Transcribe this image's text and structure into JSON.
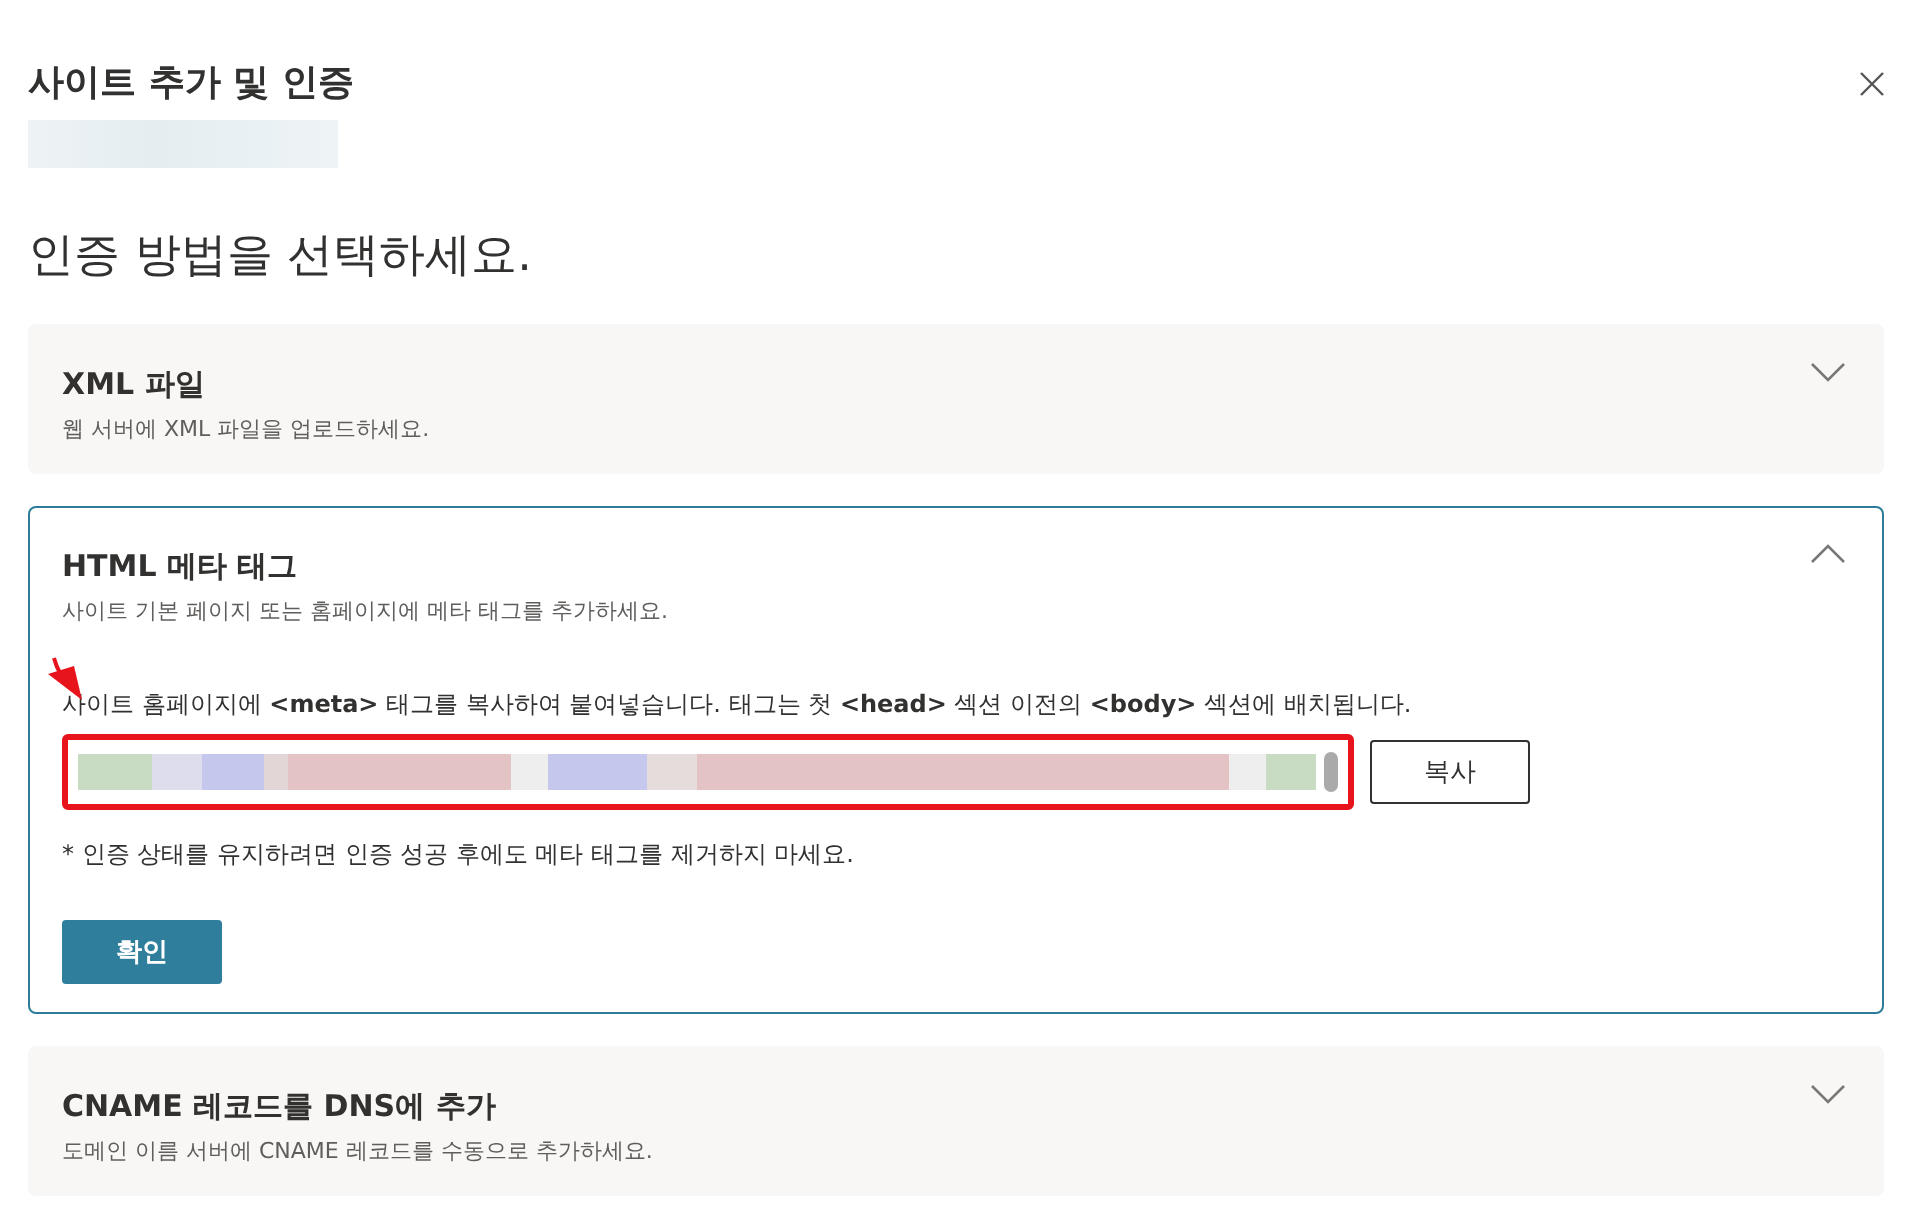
{
  "dialog": {
    "title": "사이트 추가 및 인증",
    "heading": "인증 방법을 선택하세요."
  },
  "sections": [
    {
      "title": "XML 파일",
      "subtitle": "웹 서버에 XML 파일을 업로드하세요.",
      "expanded": false
    },
    {
      "title": "HTML 메타 태그",
      "subtitle": "사이트 기본 페이지 또는 홈페이지에 메타 태그를 추가하세요.",
      "expanded": true,
      "description": "사이트 홈페이지에 **<meta>** 태그를 복사하여 붙여넣습니다. 태그는 첫 **<head>** 섹션 이전의 **<body>** 섹션에 배치됩니다.",
      "copy_button": "복사",
      "note": "* 인증 상태를 유지하려면 인증 성공 후에도 메타 태그를 제거하지 마세요.",
      "confirm_button": "확인"
    },
    {
      "title": "CNAME 레코드를 DNS에 추가",
      "subtitle": "도메인 이름 서버에 CNAME 레코드를 수동으로 추가하세요.",
      "expanded": false
    }
  ]
}
